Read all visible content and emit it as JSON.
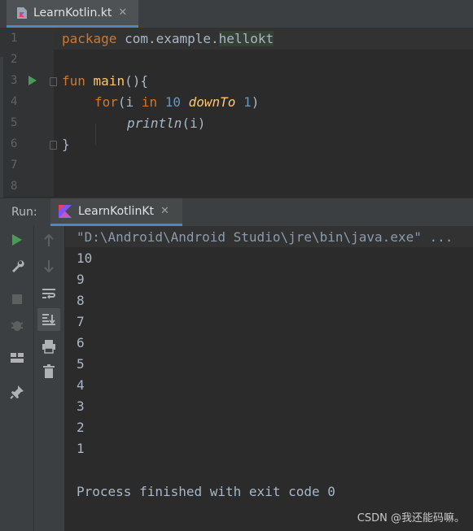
{
  "editor_tab": {
    "label": "LearnKotlin.kt",
    "close": "✕"
  },
  "editor": {
    "line_numbers": [
      "1",
      "2",
      "3",
      "4",
      "5",
      "6",
      "7",
      "8"
    ],
    "lines": {
      "l1_kw": "package",
      "l1_pkg_a": "com.example.",
      "l1_pkg_b": "hellokt",
      "l3_kw": "fun",
      "l3_name": "main",
      "l3_rest": "(){",
      "l4_kw": "for",
      "l4_open": "(i ",
      "l4_in": "in",
      "l4_start": "10",
      "l4_downto": "downTo",
      "l4_end": "1",
      "l4_close": ")",
      "l5_call": "println",
      "l5_args": "(i)",
      "l6_close": "}"
    }
  },
  "run_panel": {
    "title": "Run:",
    "tab_label": "LearnKotlinKt",
    "tab_close": "✕",
    "command": "\"D:\\Android\\Android Studio\\jre\\bin\\java.exe\" ...",
    "output": [
      "10",
      "9",
      "8",
      "7",
      "6",
      "5",
      "4",
      "3",
      "2",
      "1"
    ],
    "exit_message": "Process finished with exit code 0"
  },
  "watermark": "CSDN @我还能码嘛。",
  "colors": {
    "keyword": "#cc7832",
    "number": "#6897bb",
    "function": "#ffc66d",
    "run_green": "#499c54",
    "accent": "#4a88c7"
  }
}
